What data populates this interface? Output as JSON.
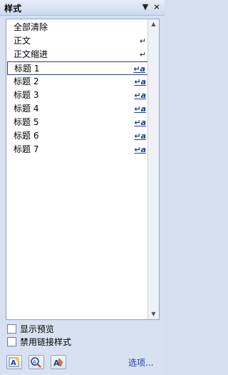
{
  "panel": {
    "title": "样式",
    "menu_glyph": "▼",
    "close_glyph": "×"
  },
  "styles": [
    {
      "label": "全部清除",
      "mark": ""
    },
    {
      "label": "正文",
      "mark": "↵"
    },
    {
      "label": "正文缩进",
      "mark": "↵"
    },
    {
      "label": "标题 1",
      "mark": "↵a",
      "selected": true
    },
    {
      "label": "标题 2",
      "mark": "↵a"
    },
    {
      "label": "标题 3",
      "mark": "↵a"
    },
    {
      "label": "标题 4",
      "mark": "↵a"
    },
    {
      "label": "标题 5",
      "mark": "↵a"
    },
    {
      "label": "标题 6",
      "mark": "↵a"
    },
    {
      "label": "标题 7",
      "mark": "↵a"
    }
  ],
  "scrollbar": {
    "up_glyph": "▲",
    "down_glyph": "▼"
  },
  "options": {
    "show_preview": {
      "label": "显示预览",
      "checked": false
    },
    "disable_linked_styles": {
      "label": "禁用链接样式",
      "checked": false
    }
  },
  "buttons": {
    "new_style_icon": "new-style-icon",
    "style_inspector_icon": "style-inspector-icon",
    "manage_styles_icon": "manage-styles-icon"
  },
  "options_link": "选项..."
}
